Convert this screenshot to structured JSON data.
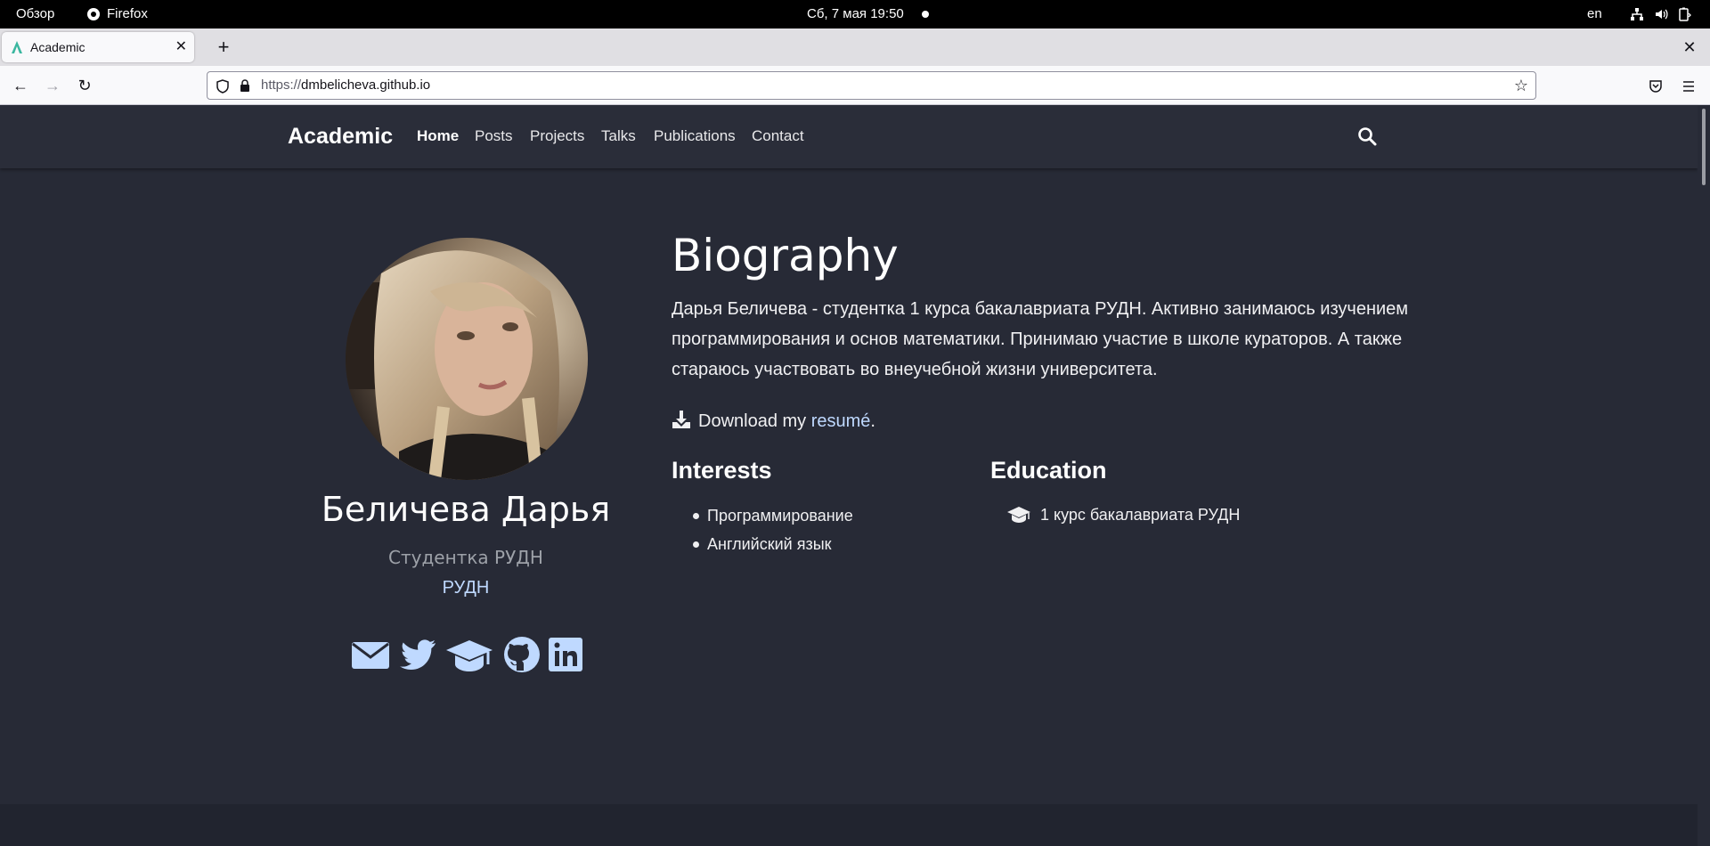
{
  "system_bar": {
    "overview": "Обзор",
    "app_name": "Firefox",
    "datetime": "Сб, 7 мая  19:50",
    "language": "en"
  },
  "browser": {
    "tab_title": "Academic",
    "url_protocol": "https://",
    "url_host": "dmbelicheva.github.io"
  },
  "site": {
    "brand": "Academic",
    "nav": [
      "Home",
      "Posts",
      "Projects",
      "Talks",
      "Publications",
      "Contact"
    ],
    "active_nav": "Home"
  },
  "profile": {
    "name": "Беличева Дарья",
    "role": "Студентка РУДН",
    "organization": "РУДН",
    "social_icons": [
      "envelope-icon",
      "twitter-icon",
      "graduation-cap-icon",
      "github-icon",
      "linkedin-icon"
    ]
  },
  "biography": {
    "title": "Biography",
    "text": "Дарья Беличева - студентка 1 курса бакалавриата РУДН. Активно занимаюсь изучением программирования и основ математики. Принимаю участие в школе кураторов. А также стараюсь участвовать во внеучебной жизни университета.",
    "download_prefix": "Download my ",
    "download_link": "resumé",
    "download_suffix": "."
  },
  "interests": {
    "title": "Interests",
    "items": [
      "Программирование",
      "Английский язык"
    ]
  },
  "education": {
    "title": "Education",
    "items": [
      "1 курс бакалавриата РУДН"
    ]
  },
  "colors": {
    "page_bg": "#272a36",
    "nav_bg": "#2a2d39",
    "link": "#bfd9ff",
    "muted": "#9da1a8"
  }
}
